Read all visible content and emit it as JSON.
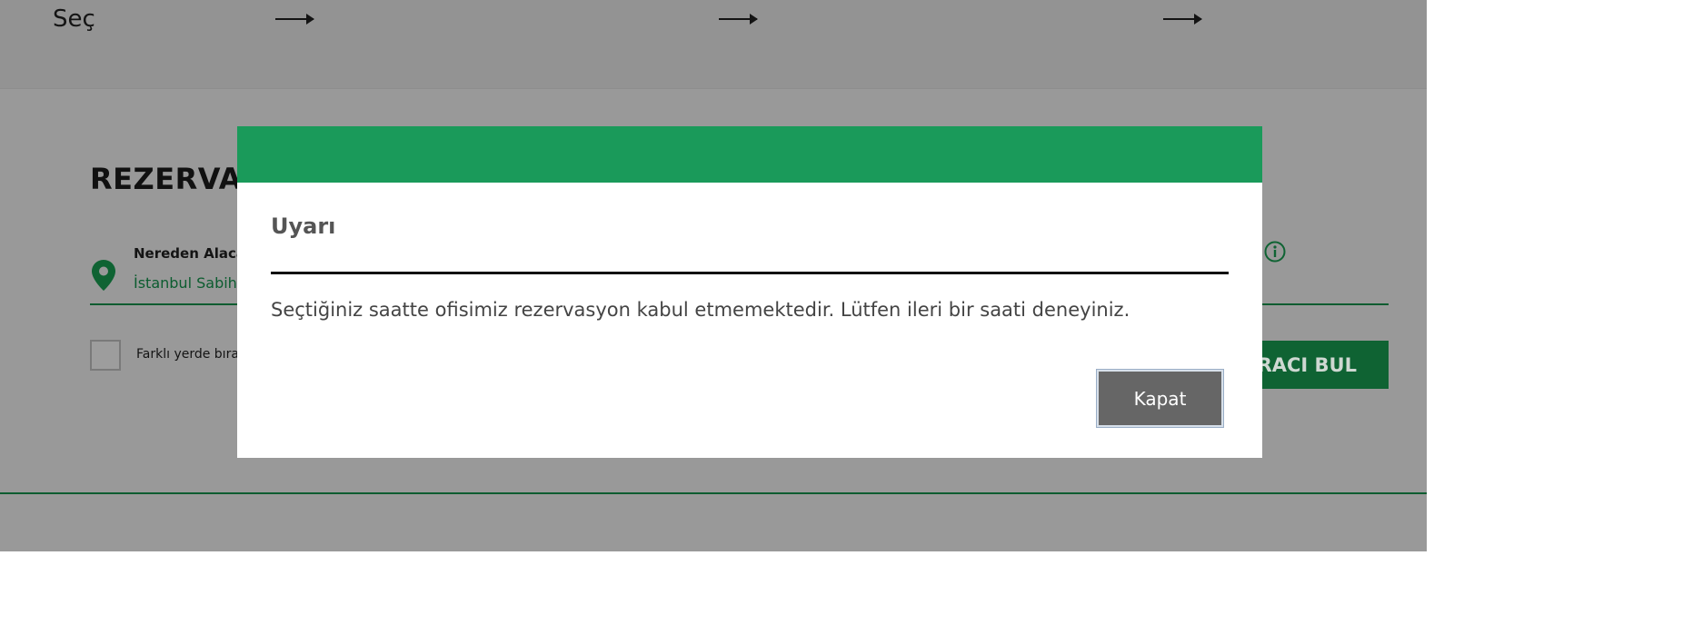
{
  "background": {
    "steps": {
      "first_label": "Seç"
    },
    "form": {
      "title": "REZERVAS",
      "pickup_label": "Nereden Alacak",
      "pickup_value": "İstanbul Sabiha",
      "different_dropoff_label": "Farklı yerde bırak",
      "find_button_label": "ARACI BUL"
    }
  },
  "modal": {
    "title": "Uyarı",
    "message": "Seçtiğiniz saatte ofisimiz rezervasyon kabul etmemektedir. Lütfen ileri bir saati deneyiniz.",
    "close_label": "Kapat"
  },
  "colors": {
    "brand_green": "#1a9a5a",
    "dark_green": "#0f6333",
    "overlay_gray": "#999999",
    "button_gray": "#666666"
  },
  "icons": [
    "arrow-right-icon",
    "location-pin-icon",
    "info-icon"
  ]
}
